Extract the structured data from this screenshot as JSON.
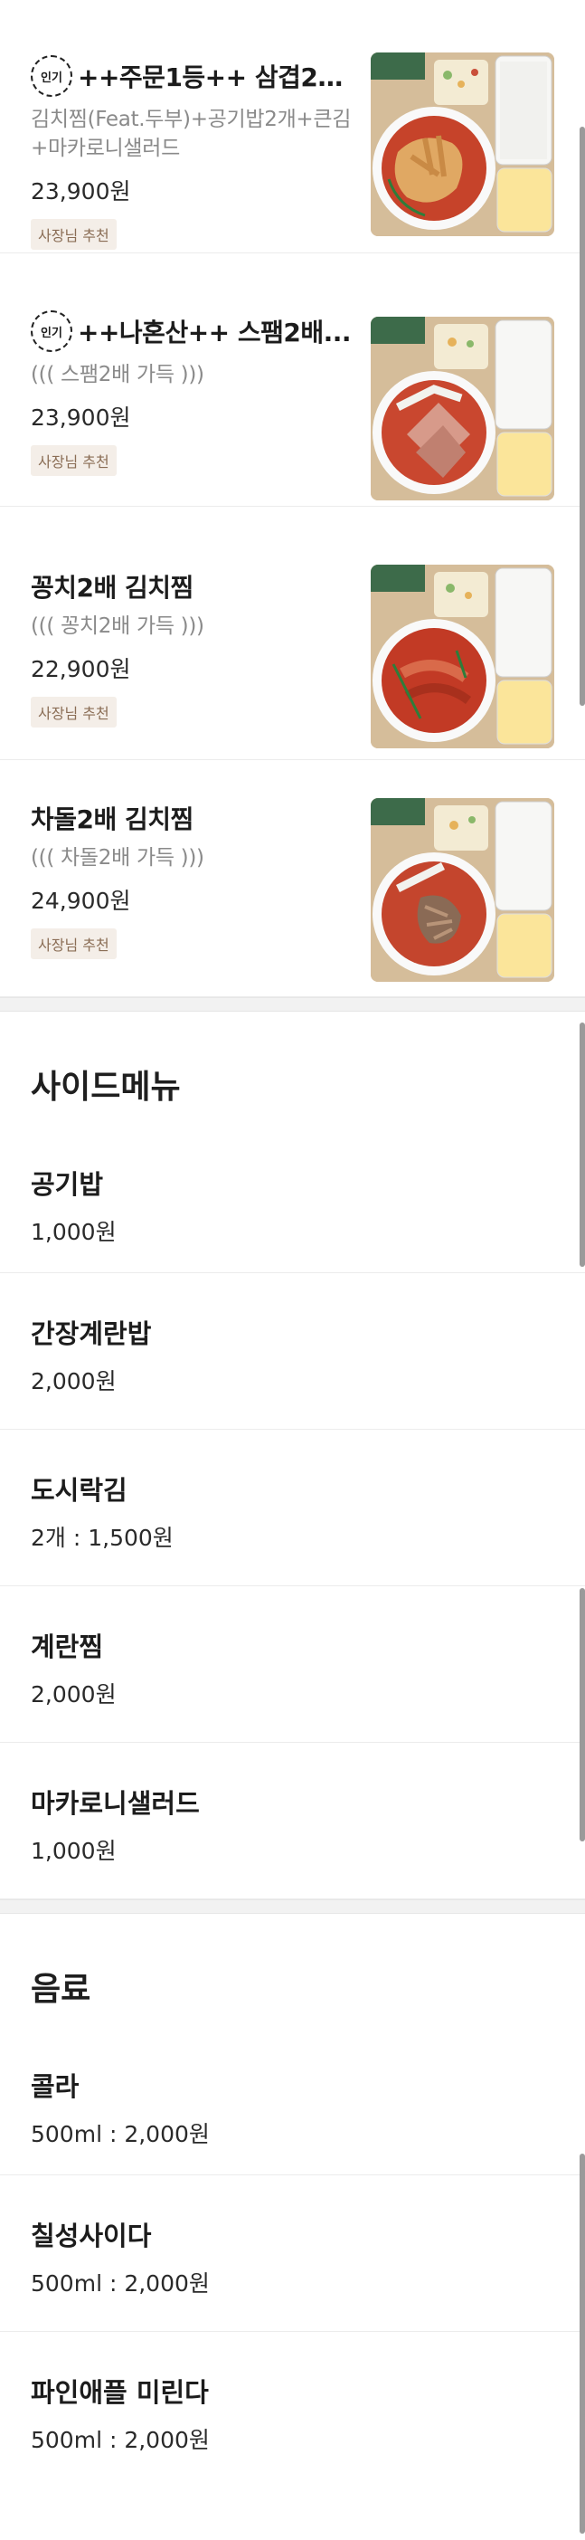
{
  "main_menu": [
    {
      "badge": "인기",
      "title": "++주문1등++ 삼겹2배...",
      "description": "김치찜(Feat.두부)+공기밥2개+큰김+마카로니샐러드",
      "price": "23,900원",
      "tag": "사장님 추천",
      "photo": "kimchi-jjim-pork-belly"
    },
    {
      "badge": "인기",
      "title": "++나혼산++ 스팸2배...",
      "description": "((( 스팸2배 가득 )))",
      "price": "23,900원",
      "tag": "사장님 추천",
      "photo": "kimchi-jjim-spam"
    },
    {
      "badge": "",
      "title": "꽁치2배 김치찜",
      "description": "((( 꽁치2배 가득 )))",
      "price": "22,900원",
      "tag": "사장님 추천",
      "photo": "kimchi-jjim-saury"
    },
    {
      "badge": "",
      "title": "차돌2배 김치찜",
      "description": "((( 차돌2배 가득 )))",
      "price": "24,900원",
      "tag": "사장님 추천",
      "photo": "kimchi-jjim-brisket"
    }
  ],
  "side_menu": {
    "title": "사이드메뉴",
    "items": [
      {
        "name": "공기밥",
        "price": "1,000원"
      },
      {
        "name": "간장계란밥",
        "price": "2,000원"
      },
      {
        "name": "도시락김",
        "price": "2개 : 1,500원"
      },
      {
        "name": "계란찜",
        "price": "2,000원"
      },
      {
        "name": "마카로니샐러드",
        "price": "1,000원"
      }
    ]
  },
  "drinks": {
    "title": "음료",
    "items": [
      {
        "name": "콜라",
        "price": "500ml : 2,000원"
      },
      {
        "name": "칠성사이다",
        "price": "500ml : 2,000원"
      },
      {
        "name": "파인애플 미린다",
        "price": "500ml : 2,000원"
      }
    ]
  },
  "colors": {
    "tag_bg": "#f4eee8",
    "tag_text": "#8a6d55",
    "divider": "#f2f2f2"
  }
}
